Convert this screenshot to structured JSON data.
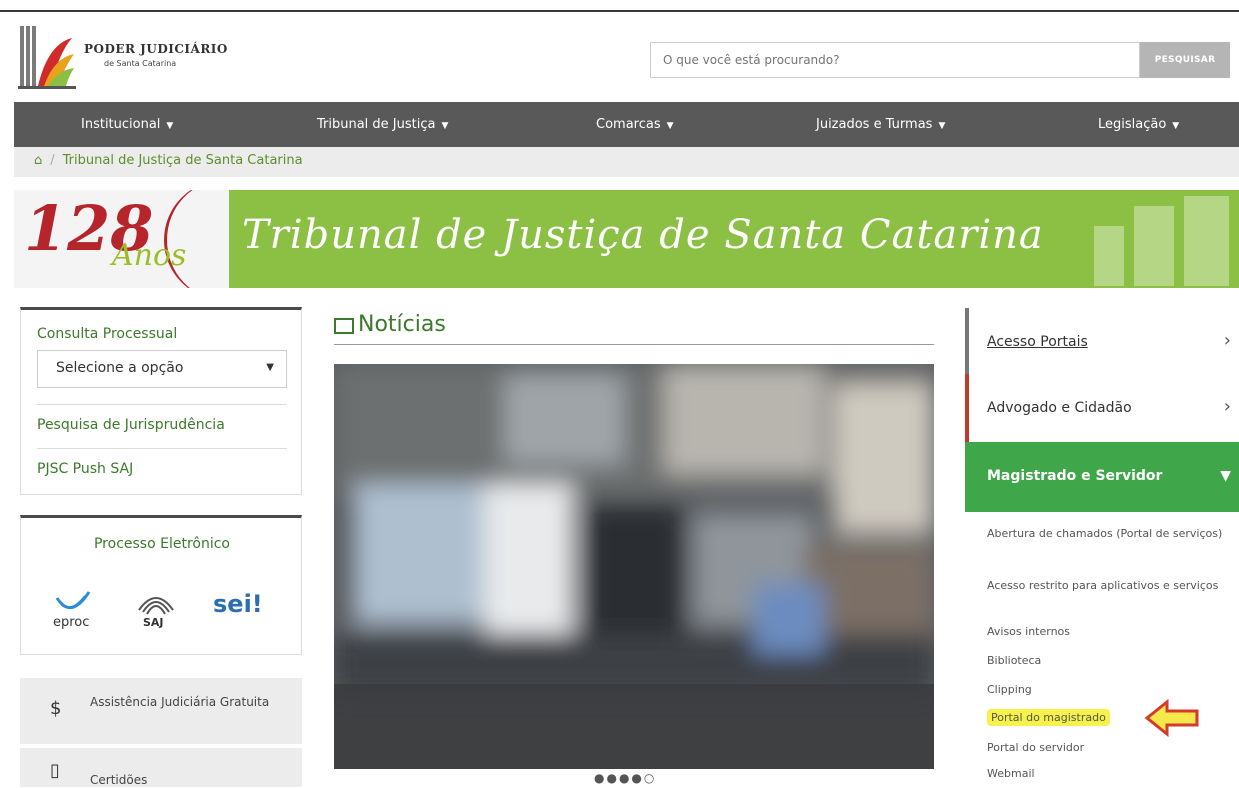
{
  "header": {
    "logo_title": "PODER JUDICIÁRIO",
    "logo_subtitle": "de Santa Catarina",
    "search_placeholder": "O que você está procurando?",
    "search_button": "PESQUISAR"
  },
  "nav": {
    "items": [
      {
        "label": "Institucional"
      },
      {
        "label": "Tribunal de Justiça"
      },
      {
        "label": "Comarcas"
      },
      {
        "label": "Juizados e Turmas"
      },
      {
        "label": "Legislação"
      }
    ]
  },
  "breadcrumb": {
    "home_icon": "home-icon",
    "current": "Tribunal de Justiça de Santa Catarina"
  },
  "banner": {
    "number": "128",
    "anos": "Anos",
    "title": "Tribunal de Justiça de Santa Catarina"
  },
  "consulta": {
    "title": "Consulta Processual",
    "select_value": "Selecione a opção",
    "link_jurisprudencia": "Pesquisa de Jurisprudência",
    "link_push": "PJSC Push SAJ"
  },
  "processo": {
    "title": "Processo Eletrônico",
    "logos": [
      "eproc",
      "SAJ",
      "sei!"
    ]
  },
  "side_items": [
    {
      "symbol": "$",
      "label": "Assistência Judiciária Gratuita"
    },
    {
      "symbol": "▯",
      "label": "Certidões"
    }
  ],
  "news": {
    "title": "Notícias",
    "carousel_dots": "●●●●○"
  },
  "right_menu": {
    "sections": [
      {
        "label": "Acesso Portais",
        "color": "#777777"
      },
      {
        "label": "Advogado e Cidadão",
        "color": "#c0392b"
      },
      {
        "label": "Magistrado e Servidor",
        "color": "#3fa64a"
      }
    ],
    "links": [
      "Abertura de chamados (Portal de serviços)",
      "Acesso restrito para aplicativos e serviços",
      "Avisos internos",
      "Biblioteca",
      "Clipping",
      "Portal do magistrado",
      "Portal do servidor",
      "Webmail"
    ]
  },
  "colors": {
    "nav_bg": "#595959",
    "brand_green": "#3fa64a",
    "banner_green": "#8cc044",
    "banner_red": "#b5252b",
    "highlight": "#f6f24a"
  }
}
